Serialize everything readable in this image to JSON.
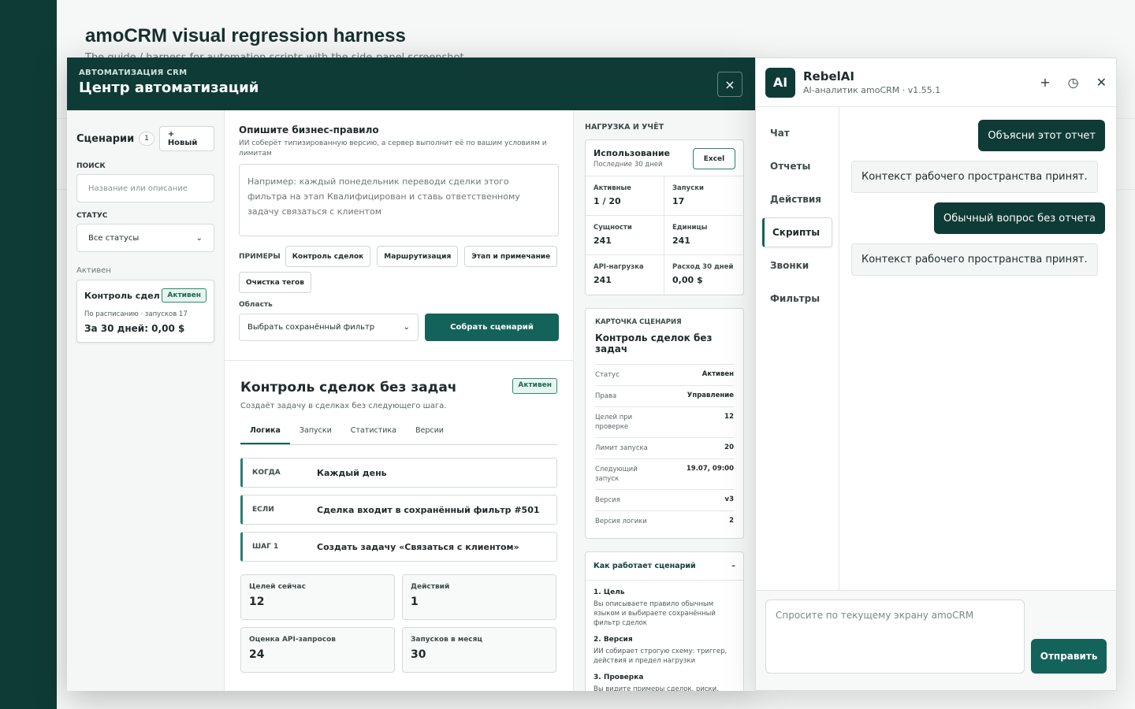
{
  "page": {
    "title": "amoCRM visual regression harness",
    "subtitle": "The guide / harness for automation scripts with the side-panel screenshot"
  },
  "modal": {
    "kicker": "АВТОМАТИЗАЦИЯ CRM",
    "title": "Центр автоматизаций",
    "close": "×"
  },
  "left": {
    "title": "Сценарии",
    "count": "1",
    "new_label": "+ Новый",
    "search_label": "ПОИСК",
    "search_placeholder": "Название или описание",
    "status_label": "СТАТУС",
    "status_value": "Все статусы",
    "group_label": "Активен",
    "card": {
      "name": "Контроль сдел...",
      "badge": "Активен",
      "meta": "По расписанию · запусков 17",
      "cost": "За 30 дней: 0,00 $"
    }
  },
  "builder": {
    "title": "Опишите бизнес-правило",
    "desc": "ИИ соберёт типизированную версию, а сервер выполнит её по вашим условиям и лимитам",
    "placeholder": "Например: каждый понедельник переводи сделки этого фильтра на этап Квалифицирован и ставь ответственному задачу связаться с клиентом",
    "examples_label": "ПРИМЕРЫ",
    "examples": [
      "Контроль сделок",
      "Маршрутизация",
      "Этап и примечание",
      "Очистка тегов"
    ],
    "area_label": "Область",
    "area_value": "Выбрать сохранённый фильтр",
    "build_label": "Собрать сценарий"
  },
  "detail": {
    "title": "Контроль сделок без задач",
    "badge": "Активен",
    "desc": "Создаёт задачу в сделках без следующего шага.",
    "tabs": [
      "Логика",
      "Запуски",
      "Статистика",
      "Версии"
    ],
    "rules": [
      {
        "k": "КОГДА",
        "v": "Каждый день"
      },
      {
        "k": "ЕСЛИ",
        "v": "Сделка входит в сохранённый фильтр #501"
      },
      {
        "k": "ШАГ 1",
        "v": "Создать задачу «Связаться с клиентом»"
      }
    ],
    "stats": [
      {
        "k": "Целей сейчас",
        "v": "12"
      },
      {
        "k": "Действий",
        "v": "1"
      },
      {
        "k": "Оценка API-запросов",
        "v": "24"
      },
      {
        "k": "Запусков в месяц",
        "v": "30"
      }
    ]
  },
  "right": {
    "section": "НАГРУЗКА И УЧЁТ",
    "usage_title": "Использование",
    "usage_sub": "Последние 30 дней",
    "excel": "Excel",
    "usage": [
      {
        "k": "Активные",
        "v": "1 / 20"
      },
      {
        "k": "Запуски",
        "v": "17"
      },
      {
        "k": "Сущности",
        "v": "241"
      },
      {
        "k": "Единицы",
        "v": "241"
      },
      {
        "k": "API-нагрузка",
        "v": "241"
      },
      {
        "k": "Расход 30 дней",
        "v": "0,00 $"
      }
    ],
    "card_kicker": "КАРТОЧКА СЦЕНАРИЯ",
    "card_title": "Контроль сделок без задач",
    "card_rows": [
      {
        "k": "Статус",
        "v": "Активен"
      },
      {
        "k": "Права",
        "v": "Управление"
      },
      {
        "k": "Целей при проверке",
        "v": "12"
      },
      {
        "k": "Лимит запуска",
        "v": "20"
      },
      {
        "k": "Следующий запуск",
        "v": "19.07, 09:00"
      },
      {
        "k": "Версия",
        "v": "v3"
      },
      {
        "k": "Версия логики",
        "v": "2"
      }
    ],
    "how_title": "Как работает сценарий",
    "how_toggle": "–",
    "how": [
      {
        "t": "1. Цель",
        "d": "Вы описываете правило обычным языком и выбираете сохранённый фильтр сделок"
      },
      {
        "t": "2. Версия",
        "d": "ИИ собирает строгую схему: триггер, действия и предел нагрузки"
      },
      {
        "t": "3. Проверка",
        "d": "Вы видите примеры сделок, риски, бюджет и отдельно подтверждаете"
      }
    ]
  },
  "ai": {
    "logo": "AI",
    "title": "RebelAI",
    "version": "AI-аналитик amoCRM · v1.55.1",
    "nav": [
      "Чат",
      "Отчеты",
      "Действия",
      "Скрипты",
      "Звонки",
      "Фильтры"
    ],
    "messages": [
      {
        "role": "user",
        "text": "Объясни этот отчет"
      },
      {
        "role": "bot",
        "text": "Контекст рабочего пространства принят."
      },
      {
        "role": "user",
        "text": "Обычный вопрос без отчета"
      },
      {
        "role": "bot",
        "text": "Контекст рабочего пространства принят."
      }
    ],
    "input_placeholder": "Спросите по текущему экрану amoCRM",
    "send": "Отправить"
  }
}
